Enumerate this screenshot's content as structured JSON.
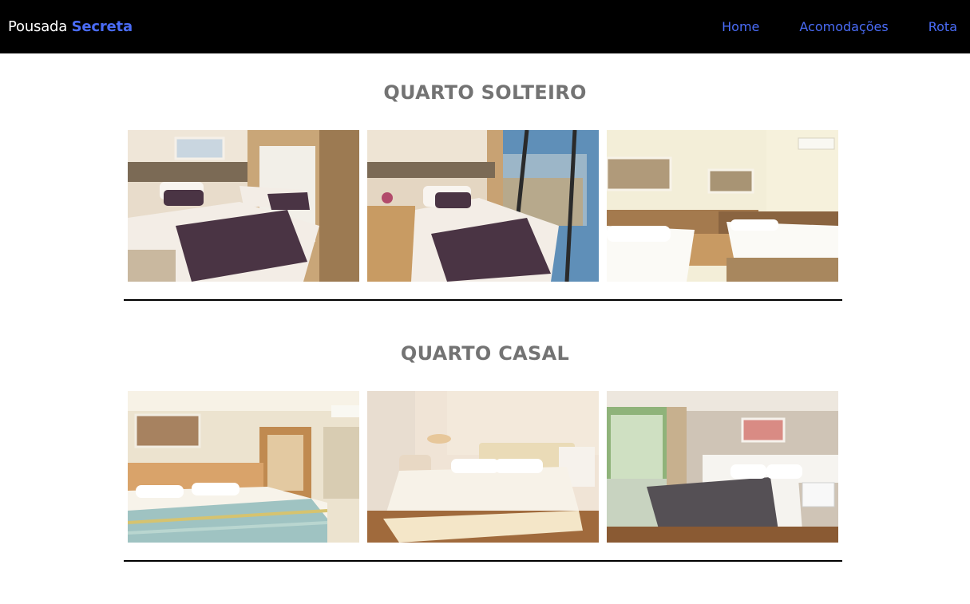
{
  "nav": {
    "brand_part1": "Pousada ",
    "brand_part2": "Secreta",
    "links": [
      "Home",
      "Acomodações",
      "Rota"
    ],
    "accent_color": "#4a6cf7"
  },
  "sections": [
    {
      "title": "QUARTO SOLTEIRO"
    },
    {
      "title": "QUARTO CASAL"
    }
  ]
}
